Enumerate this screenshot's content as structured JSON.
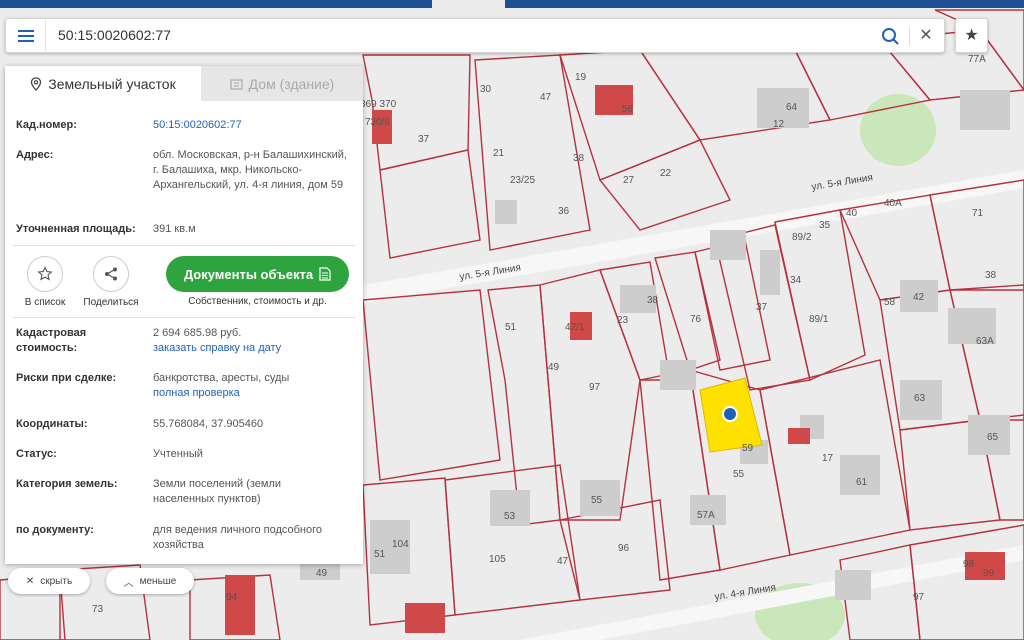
{
  "search": {
    "query": "50:15:0020602:77",
    "menu_icon": "menu-icon",
    "search_icon": "search-icon",
    "clear_icon": "close-icon",
    "clear_symbol": "✕",
    "favorite_icon": "star-icon",
    "favorite_symbol": "★"
  },
  "panel": {
    "tabs": [
      {
        "label": "Земельный участок",
        "icon": "location-pin-icon",
        "active": true
      },
      {
        "label": "Дом (здание)",
        "icon": "building-icon",
        "active": false
      }
    ],
    "cad_number": {
      "label": "Кад.номер:",
      "value": "50:15:0020602:77"
    },
    "address": {
      "label": "Адрес:",
      "value": "обл. Московская, р-н Балашихинский, г. Балашиха, мкр. Никольско-Архангельский, ул. 4-я линия, дом 59"
    },
    "area": {
      "label": "Уточненная площадь:",
      "value": "391 кв.м"
    },
    "actions": {
      "to_list": {
        "label": "В список",
        "icon": "star-outline-icon"
      },
      "share": {
        "label": "Поделиться",
        "icon": "share-icon"
      },
      "documents": {
        "label": "Документы объекта",
        "icon": "document-icon",
        "subtitle": "Собственник, стоимость и др."
      }
    },
    "cad_value": {
      "label": "Кадастровая стоимость:",
      "value": "2 694 685.98 руб.",
      "link": "заказать справку на дату"
    },
    "risks": {
      "label": "Риски при сделке:",
      "value": "банкротства, аресты, суды",
      "link": "полная проверка"
    },
    "coordinates": {
      "label": "Координаты:",
      "value": "55.768084, 37.905460"
    },
    "status": {
      "label": "Статус:",
      "value": "Учтенный"
    },
    "category": {
      "label": "Категория земель:",
      "value": "Земли поселений (земли населенных пунктов)"
    },
    "by_document": {
      "label": "по документу:",
      "value": "для ведения личного подсобного хозяйства"
    }
  },
  "bottom": {
    "hide": {
      "label": "скрыть",
      "symbol": "✕"
    },
    "less": {
      "label": "меньше",
      "symbol": "︿"
    }
  },
  "map": {
    "streets": [
      "ул. 5-я Линия",
      "ул. 5-я Линия",
      "ул. 4-я Линия"
    ],
    "numbers": [
      "30",
      "47",
      "19",
      "56",
      "64",
      "12",
      "37",
      "21",
      "38",
      "27",
      "22",
      "23/25",
      "36",
      "40",
      "40А",
      "71",
      "38",
      "89/2",
      "35",
      "34",
      "89/1",
      "37",
      "38",
      "51",
      "42/1",
      "23",
      "49",
      "97",
      "76",
      "58",
      "42",
      "63А",
      "63",
      "65",
      "59",
      "17",
      "61",
      "55",
      "57А",
      "53",
      "55",
      "51",
      "104",
      "105",
      "47",
      "96",
      "49",
      "73",
      "94",
      "98",
      "99",
      "97",
      "77А",
      "369 370",
      "730/6"
    ],
    "colors": {
      "parcel_border": "#b5323c",
      "highlight": "#ffe100",
      "marker": "#1e62b8",
      "building": "#cdcdcd",
      "red_building": "#d04848",
      "green": "#c9e7b8"
    }
  }
}
